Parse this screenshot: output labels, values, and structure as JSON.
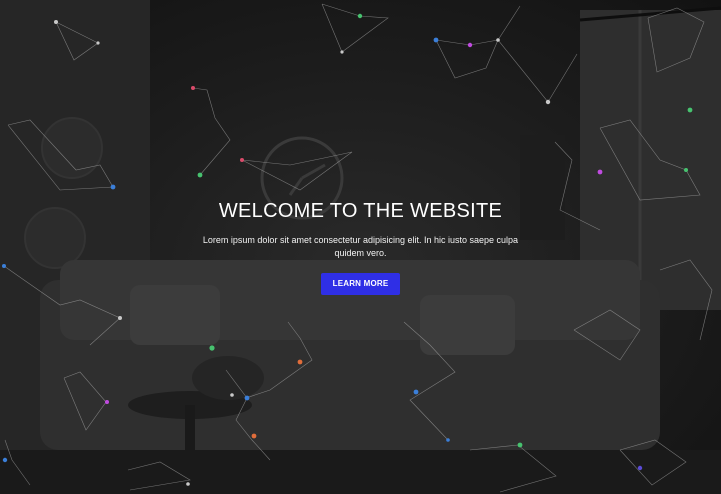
{
  "hero": {
    "title": "WELCOME TO THE WEBSITE",
    "subtitle": "Lorem ipsum dolor sit amet consectetur adipisicing elit. In hic iusto saepe culpa quidem vero.",
    "button_label": "LEARN MORE"
  },
  "colors": {
    "overlay": "#1c1c1c",
    "accent": "#2f2fe6",
    "text": "#ffffff",
    "network_lines": "#bdbdbd",
    "network_nodes": [
      "#5a4bd6",
      "#c04be0",
      "#3b7fd9",
      "#47c26f",
      "#e06d3b",
      "#d94b6a",
      "#c9c9c9"
    ]
  },
  "background": {
    "description_icons": [
      "sofa-icon",
      "wall-clock-icon",
      "window-icon",
      "plant-shelf-icon",
      "coffee-table-icon"
    ]
  }
}
